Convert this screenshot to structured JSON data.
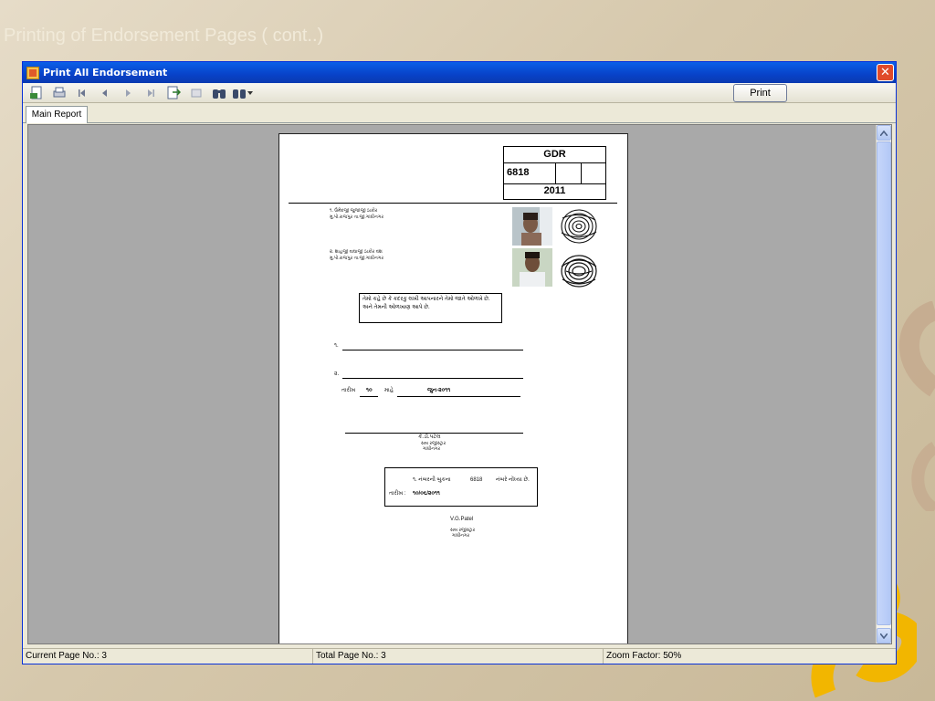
{
  "slide": {
    "title": "Printing of Endorsement Pages ( cont..)"
  },
  "window": {
    "title": "Print All Endorsement",
    "close_glyph": "✕"
  },
  "toolbar": {
    "icons": [
      "export-icon",
      "print-icon",
      "first-page-icon",
      "previous-page-icon",
      "next-page-icon",
      "last-page-icon",
      "go-to-page-icon",
      "stop-icon",
      "search-icon",
      "zoom-icon",
      "dropdown-arrow-icon"
    ],
    "print_label": "Print"
  },
  "tabs": [
    {
      "label": "Main Report"
    }
  ],
  "report": {
    "gdr_label": "GDR",
    "gdr_number": "6818",
    "gdr_year": "2011",
    "party1_line1": "૧.  ઉમેદજી જુજાજી ઠાકોર",
    "party1_line2": "     મુ.પો.રાજપુર તા.જી.ગાંધીનગર",
    "party2_line1": "૨.  શાહજી વાઘાજી ઠાકોર વંશ",
    "party2_line2": "     મુ.પો.રાજપુર તા.જી.ગાંધીનગર",
    "note_line1": "તેમો કહે છે કે કદરકુ લખી આપનારને તેમો જાતે ઓળખે છે.",
    "note_line2": "અને તેમની ઓળખાણ આપે છે.",
    "witness1_num": "૧.",
    "witness2_num": "૨.",
    "date_label": "તારીખ",
    "date_day": "૧૦",
    "month_label": "માહે",
    "date_month": "જુન-૨૦૧૧",
    "officer_name": "કે.ડી.પટેલ",
    "officer_line2": "સબ રજીસ્ટ્રાર",
    "officer_line3": "ગાંધીનગર",
    "reg_text_pre": "૧.  નંબરની બુકના",
    "reg_number": "6818",
    "reg_text_post": "નંબરે નોંધ્યા છે.",
    "reg_date_label": "તારીખ :",
    "reg_date": "૧૦/૦૬/૨૦૧૧",
    "signatory": "V.G.Patel",
    "signatory_line2": "સબ રજીસ્ટ્રાર",
    "signatory_line3": "ગાંધીનગર"
  },
  "status": {
    "current_page": "Current Page No.: 3",
    "total_pages": "Total Page No.: 3",
    "zoom": "Zoom Factor: 50%"
  },
  "colors": {
    "title_bar": "#0842c8",
    "close_button": "#e04a2a",
    "viewer_background": "#a9a9a9",
    "slide_background": "#d6c8ac",
    "deco_accent": "#f2b600"
  }
}
